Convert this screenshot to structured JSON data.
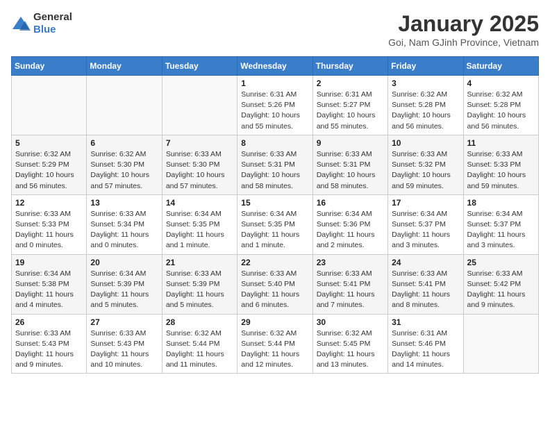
{
  "logo": {
    "general": "General",
    "blue": "Blue"
  },
  "title": "January 2025",
  "location": "Goi, Nam GJinh Province, Vietnam",
  "headers": [
    "Sunday",
    "Monday",
    "Tuesday",
    "Wednesday",
    "Thursday",
    "Friday",
    "Saturday"
  ],
  "weeks": [
    [
      {
        "day": "",
        "info": ""
      },
      {
        "day": "",
        "info": ""
      },
      {
        "day": "",
        "info": ""
      },
      {
        "day": "1",
        "info": "Sunrise: 6:31 AM\nSunset: 5:26 PM\nDaylight: 10 hours\nand 55 minutes."
      },
      {
        "day": "2",
        "info": "Sunrise: 6:31 AM\nSunset: 5:27 PM\nDaylight: 10 hours\nand 55 minutes."
      },
      {
        "day": "3",
        "info": "Sunrise: 6:32 AM\nSunset: 5:28 PM\nDaylight: 10 hours\nand 56 minutes."
      },
      {
        "day": "4",
        "info": "Sunrise: 6:32 AM\nSunset: 5:28 PM\nDaylight: 10 hours\nand 56 minutes."
      }
    ],
    [
      {
        "day": "5",
        "info": "Sunrise: 6:32 AM\nSunset: 5:29 PM\nDaylight: 10 hours\nand 56 minutes."
      },
      {
        "day": "6",
        "info": "Sunrise: 6:32 AM\nSunset: 5:30 PM\nDaylight: 10 hours\nand 57 minutes."
      },
      {
        "day": "7",
        "info": "Sunrise: 6:33 AM\nSunset: 5:30 PM\nDaylight: 10 hours\nand 57 minutes."
      },
      {
        "day": "8",
        "info": "Sunrise: 6:33 AM\nSunset: 5:31 PM\nDaylight: 10 hours\nand 58 minutes."
      },
      {
        "day": "9",
        "info": "Sunrise: 6:33 AM\nSunset: 5:31 PM\nDaylight: 10 hours\nand 58 minutes."
      },
      {
        "day": "10",
        "info": "Sunrise: 6:33 AM\nSunset: 5:32 PM\nDaylight: 10 hours\nand 59 minutes."
      },
      {
        "day": "11",
        "info": "Sunrise: 6:33 AM\nSunset: 5:33 PM\nDaylight: 10 hours\nand 59 minutes."
      }
    ],
    [
      {
        "day": "12",
        "info": "Sunrise: 6:33 AM\nSunset: 5:33 PM\nDaylight: 11 hours\nand 0 minutes."
      },
      {
        "day": "13",
        "info": "Sunrise: 6:33 AM\nSunset: 5:34 PM\nDaylight: 11 hours\nand 0 minutes."
      },
      {
        "day": "14",
        "info": "Sunrise: 6:34 AM\nSunset: 5:35 PM\nDaylight: 11 hours\nand 1 minute."
      },
      {
        "day": "15",
        "info": "Sunrise: 6:34 AM\nSunset: 5:35 PM\nDaylight: 11 hours\nand 1 minute."
      },
      {
        "day": "16",
        "info": "Sunrise: 6:34 AM\nSunset: 5:36 PM\nDaylight: 11 hours\nand 2 minutes."
      },
      {
        "day": "17",
        "info": "Sunrise: 6:34 AM\nSunset: 5:37 PM\nDaylight: 11 hours\nand 3 minutes."
      },
      {
        "day": "18",
        "info": "Sunrise: 6:34 AM\nSunset: 5:37 PM\nDaylight: 11 hours\nand 3 minutes."
      }
    ],
    [
      {
        "day": "19",
        "info": "Sunrise: 6:34 AM\nSunset: 5:38 PM\nDaylight: 11 hours\nand 4 minutes."
      },
      {
        "day": "20",
        "info": "Sunrise: 6:34 AM\nSunset: 5:39 PM\nDaylight: 11 hours\nand 5 minutes."
      },
      {
        "day": "21",
        "info": "Sunrise: 6:33 AM\nSunset: 5:39 PM\nDaylight: 11 hours\nand 5 minutes."
      },
      {
        "day": "22",
        "info": "Sunrise: 6:33 AM\nSunset: 5:40 PM\nDaylight: 11 hours\nand 6 minutes."
      },
      {
        "day": "23",
        "info": "Sunrise: 6:33 AM\nSunset: 5:41 PM\nDaylight: 11 hours\nand 7 minutes."
      },
      {
        "day": "24",
        "info": "Sunrise: 6:33 AM\nSunset: 5:41 PM\nDaylight: 11 hours\nand 8 minutes."
      },
      {
        "day": "25",
        "info": "Sunrise: 6:33 AM\nSunset: 5:42 PM\nDaylight: 11 hours\nand 9 minutes."
      }
    ],
    [
      {
        "day": "26",
        "info": "Sunrise: 6:33 AM\nSunset: 5:43 PM\nDaylight: 11 hours\nand 9 minutes."
      },
      {
        "day": "27",
        "info": "Sunrise: 6:33 AM\nSunset: 5:43 PM\nDaylight: 11 hours\nand 10 minutes."
      },
      {
        "day": "28",
        "info": "Sunrise: 6:32 AM\nSunset: 5:44 PM\nDaylight: 11 hours\nand 11 minutes."
      },
      {
        "day": "29",
        "info": "Sunrise: 6:32 AM\nSunset: 5:44 PM\nDaylight: 11 hours\nand 12 minutes."
      },
      {
        "day": "30",
        "info": "Sunrise: 6:32 AM\nSunset: 5:45 PM\nDaylight: 11 hours\nand 13 minutes."
      },
      {
        "day": "31",
        "info": "Sunrise: 6:31 AM\nSunset: 5:46 PM\nDaylight: 11 hours\nand 14 minutes."
      },
      {
        "day": "",
        "info": ""
      }
    ]
  ]
}
